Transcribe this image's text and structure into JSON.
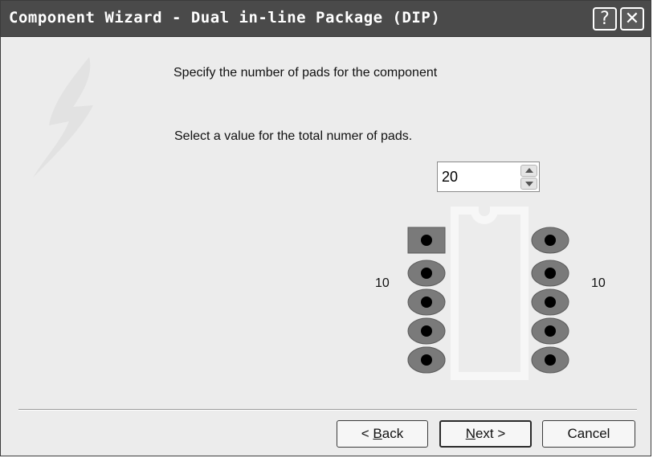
{
  "window": {
    "title": "Component Wizard - Dual in-line Package (DIP)",
    "help_button": "?",
    "close_button": "✕"
  },
  "content": {
    "heading": "Specify the number of pads for the component",
    "prompt": "Select a value for the total numer of pads.",
    "total_pads_value": "20"
  },
  "diagram": {
    "left_count": "10",
    "right_count": "10"
  },
  "buttons": {
    "back_prefix": "< ",
    "back_mnemonic": "B",
    "back_rest": "ack",
    "next_mnemonic": "N",
    "next_rest": "ext >",
    "cancel": "Cancel"
  },
  "colors": {
    "titlebar": "#4a4a4a",
    "dialog_bg": "#ececec",
    "pad": "#7a7a7a"
  },
  "icons": [
    "help-icon",
    "close-icon",
    "spin-up-icon",
    "spin-down-icon"
  ]
}
